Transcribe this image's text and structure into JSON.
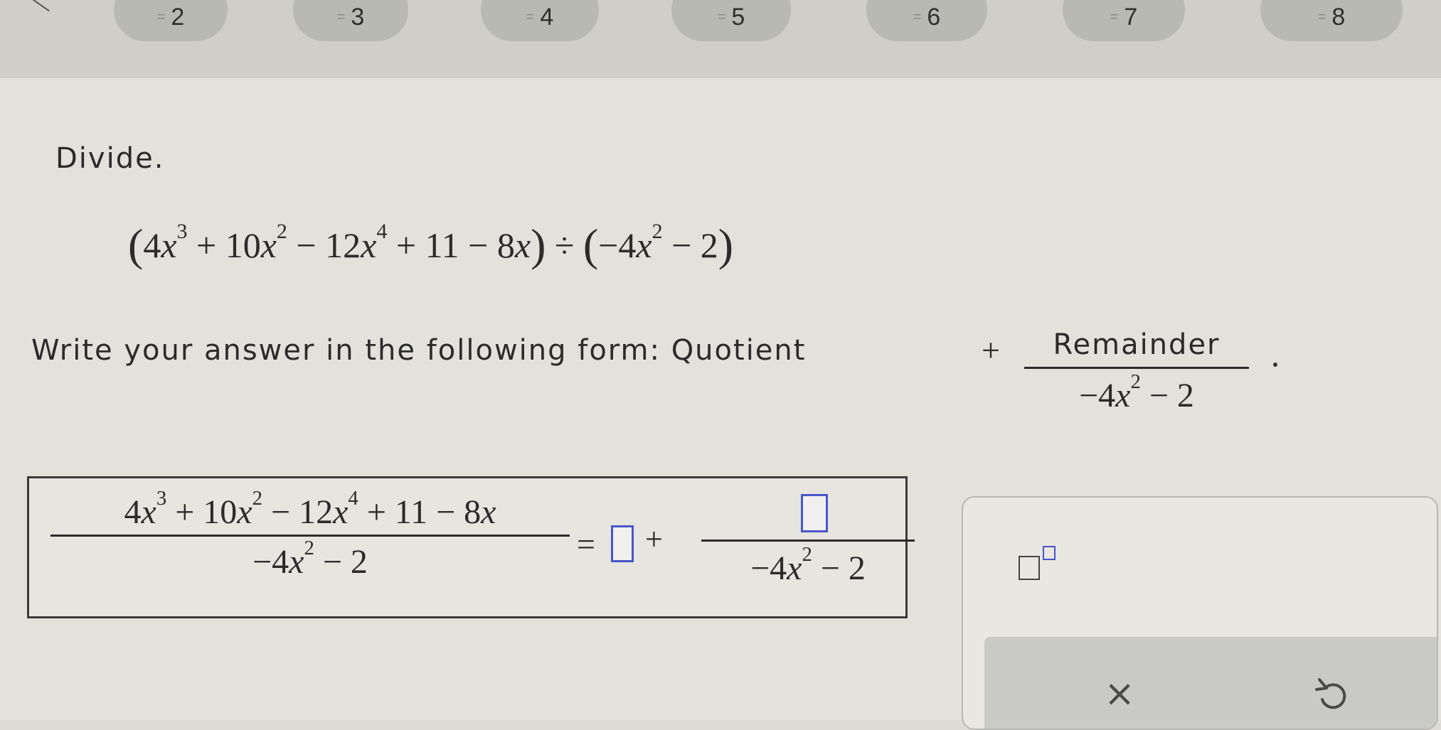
{
  "nav": {
    "questions": [
      {
        "label": "2"
      },
      {
        "label": "3"
      },
      {
        "label": "4"
      },
      {
        "label": "5"
      },
      {
        "label": "6"
      },
      {
        "label": "7"
      },
      {
        "label": "8"
      }
    ]
  },
  "problem": {
    "heading": "Divide.",
    "dividend": {
      "open": "(",
      "t1_coef": "4",
      "t1_var": "x",
      "t1_exp": "3",
      "op1": " + 10",
      "t2_var": "x",
      "t2_exp": "2",
      "op2": " − 12",
      "t3_var": "x",
      "t3_exp": "4",
      "op3": " + 11 − 8",
      "t4_var": "x",
      "close": ")"
    },
    "div_sign": " ÷ ",
    "divisor": {
      "open": "(",
      "lead": "−4",
      "var": "x",
      "exp": "2",
      "tail": " − 2",
      "close": ")"
    }
  },
  "instruction": {
    "text": "Write your answer in the following form: Quotient",
    "plus": "+",
    "fraction_numerator": "Remainder",
    "den_lead": "−4",
    "den_var": "x",
    "den_exp": "2",
    "den_tail": " − 2"
  },
  "answer": {
    "lhs_num": {
      "c1": "4",
      "v1": "x",
      "e1": "3",
      "c2": " + 10",
      "v2": "x",
      "e2": "2",
      "c3": " − 12",
      "v3": "x",
      "e3": "4",
      "c4": " + 11 − 8",
      "v4": "x"
    },
    "lhs_den": {
      "lead": "−4",
      "var": "x",
      "exp": "2",
      "tail": " − 2"
    },
    "equals": "=",
    "plus": "+",
    "rhs_den": {
      "lead": "−4",
      "var": "x",
      "exp": "2",
      "tail": " − 2"
    },
    "quotient_value": "",
    "remainder_value": ""
  },
  "keypad": {
    "clear_symbol": "×"
  },
  "colors": {
    "input_border": "#4a55c9",
    "background": "#e2e1dc",
    "topbar": "#cfcec9",
    "pill": "#b9b9b4"
  }
}
